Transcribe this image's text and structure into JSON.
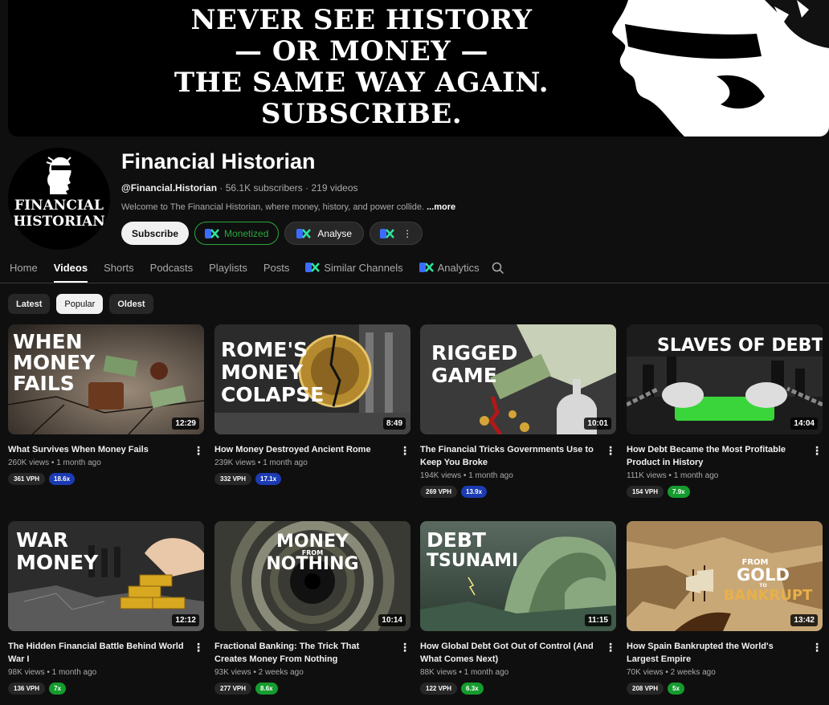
{
  "banner": {
    "lines": [
      "NEVER SEE HISTORY",
      "— OR MONEY —",
      "THE SAME WAY AGAIN.",
      "SUBSCRIBE."
    ]
  },
  "channel": {
    "avatar_lines": [
      "FINANCIAL",
      "HISTORIAN"
    ],
    "name": "Financial Historian",
    "handle": "@Financial.Historian",
    "subscribers": "56.1K subscribers",
    "videos": "219 videos",
    "separator": "·",
    "description": "Welcome to The Financial Historian, where money, history, and power collide.",
    "more": "...more"
  },
  "buttons": {
    "subscribe": "Subscribe",
    "monetized": "Monetized",
    "analyse": "Analyse",
    "dots": "⋮"
  },
  "tabs": [
    "Home",
    "Videos",
    "Shorts",
    "Podcasts",
    "Playlists",
    "Posts",
    "Similar Channels",
    "Analytics"
  ],
  "active_tab": "Videos",
  "chips": [
    "Latest",
    "Popular",
    "Oldest"
  ],
  "active_chip": "Popular",
  "videos": [
    {
      "title": "What Survives When Money Fails",
      "views": "260K views",
      "age": "1 month ago",
      "duration": "12:29",
      "vph": "361 VPH",
      "mult": "18.6x",
      "mult_color": "blue",
      "thumb_text": [
        "WHEN",
        "MONEY",
        "FAILS"
      ]
    },
    {
      "title": "How Money Destroyed Ancient Rome",
      "views": "239K views",
      "age": "1 month ago",
      "duration": "8:49",
      "vph": "332 VPH",
      "mult": "17.1x",
      "mult_color": "blue",
      "thumb_text": [
        "ROME'S",
        "MONEY",
        "COLAPSE"
      ]
    },
    {
      "title": "The Financial Tricks Governments Use to Keep You Broke",
      "views": "194K views",
      "age": "1 month ago",
      "duration": "10:01",
      "vph": "269 VPH",
      "mult": "13.9x",
      "mult_color": "blue",
      "thumb_text": [
        "RIGGED",
        "GAME"
      ]
    },
    {
      "title": "How Debt Became the Most Profitable Product in History",
      "views": "111K views",
      "age": "1 month ago",
      "duration": "14:04",
      "vph": "154 VPH",
      "mult": "7.9x",
      "mult_color": "green",
      "thumb_text": [
        "SLAVES OF DEBT"
      ]
    },
    {
      "title": "The Hidden Financial Battle Behind World War I",
      "views": "98K views",
      "age": "1 month ago",
      "duration": "12:12",
      "vph": "136 VPH",
      "mult": "7x",
      "mult_color": "green",
      "thumb_text": [
        "WAR",
        "MONEY"
      ]
    },
    {
      "title": "Fractional Banking: The Trick That Creates Money From Nothing",
      "views": "93K views",
      "age": "2 weeks ago",
      "duration": "10:14",
      "vph": "277 VPH",
      "mult": "8.6x",
      "mult_color": "green",
      "thumb_text": [
        "MONEY",
        "FROM",
        "NOTHING"
      ]
    },
    {
      "title": "How Global Debt Got Out of Control (And What Comes Next)",
      "views": "88K views",
      "age": "1 month ago",
      "duration": "11:15",
      "vph": "122 VPH",
      "mult": "6.3x",
      "mult_color": "green",
      "thumb_text": [
        "DEBT",
        "TSUNAMI"
      ]
    },
    {
      "title": "How Spain Bankrupted the World's Largest Empire",
      "views": "70K views",
      "age": "2 weeks ago",
      "duration": "13:42",
      "vph": "208 VPH",
      "mult": "5x",
      "mult_color": "green",
      "thumb_text": [
        "FROM",
        "GOLD",
        "TO",
        "BANKRUPT"
      ]
    }
  ],
  "colors": {
    "background": "#0f0f0f",
    "monetized_green": "#2ba640",
    "mult_blue": "#1c3bb3",
    "mult_green": "#159b2e"
  }
}
